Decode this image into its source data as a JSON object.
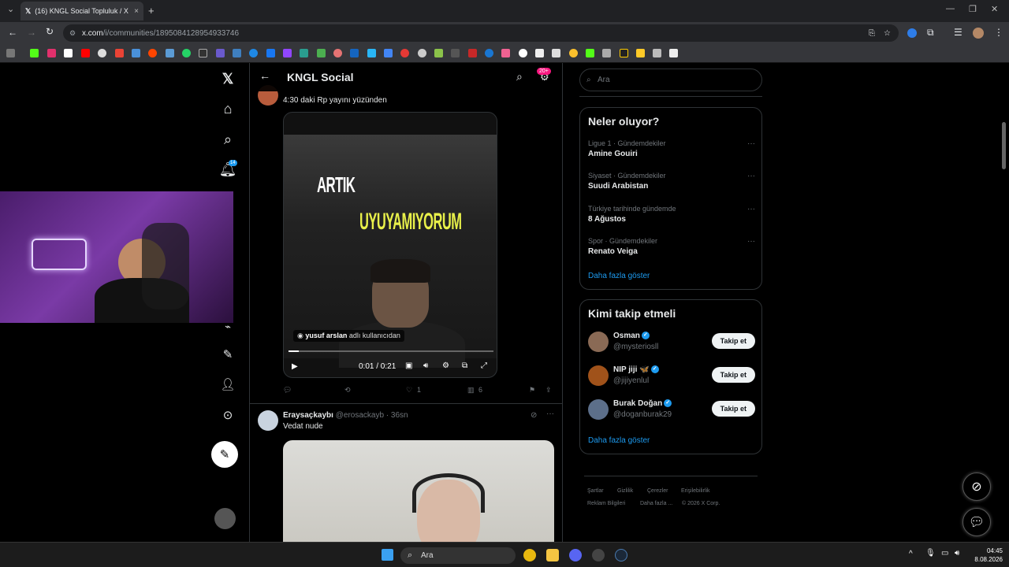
{
  "browser": {
    "tab_title": "(16) KNGL Social Topluluk / X",
    "tab_close": "×",
    "new_tab": "+",
    "url_host": "x.com",
    "url_path": "/i/communities/1895084128954933746"
  },
  "nav": {
    "notifications_badge": "14"
  },
  "header": {
    "title": "KNGL Social",
    "badge": "20+"
  },
  "post1": {
    "text": "4:30 daki Rp yayını yüzünden",
    "video_text_1": "ARTIK",
    "video_text_2": "UYUYAMIYORUM",
    "credit_user": "yusuf arslan",
    "credit_suffix": " adlı kullanıcıdan",
    "time": "0:01 / 0:21",
    "progress": 0.05,
    "likes": "1",
    "views": "6"
  },
  "post2": {
    "name": "Eraysaçkaybı",
    "handle": "@erosackayb · 36sn",
    "text": "Vedat nude"
  },
  "sidebar": {
    "search_placeholder": "Ara",
    "trends_title": "Neler oluyor?",
    "trends": [
      {
        "meta": "Ligue 1 · Gündemdekiler",
        "name": "Amine Gouiri"
      },
      {
        "meta": "Siyaset · Gündemdekiler",
        "name": "Suudi Arabistan"
      },
      {
        "meta": "Türkiye tarihinde gündemde",
        "name": "8 Ağustos"
      },
      {
        "meta": "Spor · Gündemdekiler",
        "name": "Renato Veiga"
      }
    ],
    "show_more": "Daha fazla göster",
    "who_title": "Kimi takip etmeli",
    "who": [
      {
        "name": "Osman",
        "handle": "@mysteriosll",
        "button": "Takip et"
      },
      {
        "name": "NIP jiji 🦋",
        "handle": "@jijiyenlul",
        "button": "Takip et"
      },
      {
        "name": "Burak Doğan",
        "handle": "@doganburak29",
        "button": "Takip et"
      }
    ],
    "footer": [
      "Şartlar",
      "Gizlilik",
      "Çerezler",
      "Erişilebilirlik",
      "Reklam Bilgileri",
      "Daha fazla ...",
      "© 2026 X Corp."
    ]
  },
  "taskbar": {
    "search": "Ara",
    "time": "04:45",
    "date": "8.08.2026"
  }
}
